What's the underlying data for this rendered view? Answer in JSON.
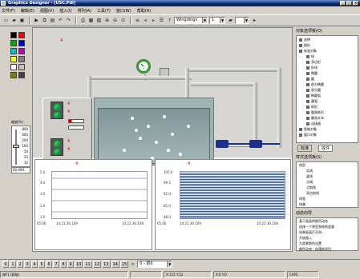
{
  "app": {
    "title": "Graphics Designer - [USC.Pdl]",
    "window_controls": [
      "_",
      "□",
      "×"
    ]
  },
  "menu": [
    "文件(F)",
    "编辑(E)",
    "视图(V)",
    "插入(I)",
    "排列(A)",
    "工具(T)",
    "窗口(W)",
    "帮助(H)"
  ],
  "toolbar": {
    "icons": [
      "new-icon",
      "open-icon",
      "save-icon",
      "run-icon",
      "copy-icon",
      "paste-icon",
      "undo-icon",
      "redo-icon",
      "print-icon",
      "grid-icon",
      "snap-icon",
      "zoom-in-icon",
      "zoom-out-icon",
      "zoom-fit-icon",
      "layer-icon",
      "align-left-icon",
      "align-center-icon",
      "property-icon",
      "help-icon"
    ],
    "font_combo": "Wingdings",
    "size_combo": "1",
    "zoom_combo": ""
  },
  "palette": {
    "colors": [
      "#000000",
      "#ff0000",
      "#00aa00",
      "#0000cc",
      "#00bfbf",
      "#c000c0",
      "#ffff00",
      "#808080",
      "#ffffff",
      "#c0c0c0",
      "#808000",
      "#404040"
    ],
    "zoom_label": "缩放(%)",
    "zoom_ticks": [
      "800",
      "400",
      "200",
      "100",
      "50",
      "25",
      "12"
    ],
    "zoom_value": "100",
    "zoom_field": "60.000"
  },
  "canvas": {
    "marker": "4",
    "panel_marks": [
      "4",
      "4",
      "4",
      "4"
    ],
    "charts": [
      {
        "ylabels": [
          "5.0",
          "4.0",
          "3.0",
          "2.0",
          "1.0"
        ],
        "xlabels": [
          "05.06",
          "14:21:36.109",
          "14:22:36.108"
        ]
      },
      {
        "ylabels": [
          "105.0",
          "99.5",
          "92.0",
          "85.0",
          "88.0"
        ],
        "xlabels": [
          "05.06",
          "14:21:36.109",
          "14:22:36.108"
        ]
      }
    ]
  },
  "objects_pane": {
    "title": "对象选项板(O)",
    "tree": [
      {
        "label": "选择",
        "icon": "cursor-icon"
      },
      {
        "label": "图形",
        "icon": "folder-icon"
      },
      {
        "label": "标准对象",
        "icon": "folder-icon"
      },
      {
        "label": "线",
        "icon": "line-icon"
      },
      {
        "label": "多边形",
        "icon": "polygon-icon"
      },
      {
        "label": "折线",
        "icon": "polyline-icon"
      },
      {
        "label": "椭圆",
        "icon": "ellipse-icon"
      },
      {
        "label": "圆",
        "icon": "circle-icon"
      },
      {
        "label": "部分椭圆",
        "icon": "pie-icon"
      },
      {
        "label": "部分圆",
        "icon": "arc-icon"
      },
      {
        "label": "椭圆弧",
        "icon": "arc-icon"
      },
      {
        "label": "圆弧",
        "icon": "arc-icon"
      },
      {
        "label": "矩形",
        "icon": "rect-icon"
      },
      {
        "label": "圆角矩形",
        "icon": "roundrect-icon"
      },
      {
        "label": "静态文本",
        "icon": "text-icon"
      },
      {
        "label": "连接器",
        "icon": "connector-icon"
      },
      {
        "label": "智能对象",
        "icon": "folder-icon"
      },
      {
        "label": "窗口对象",
        "icon": "folder-icon"
      }
    ],
    "tabs": [
      "标准",
      "控件"
    ]
  },
  "styles_pane": {
    "title": "样式选项板(S)",
    "tree": [
      "线型",
      "实线",
      "虚线",
      "点线",
      "点划线",
      "双点划线",
      "线宽",
      "线端"
    ]
  },
  "dynamic_pane": {
    "title": "动态向导",
    "items": [
      "基于画面的颜色动态",
      "连接一个原型到结构变量",
      "如果画面打开则…",
      "开始画入",
      "为背景颜色设置",
      "颜色动态 - 创建新项目"
    ]
  },
  "pagebar": {
    "tabs": [
      "0",
      "1",
      "2",
      "3",
      "4",
      "5",
      "6",
      "7",
      "8",
      "9",
      "10",
      "11",
      "12",
      "13",
      "14",
      "15"
    ],
    "layer_combo": "0 - 层0"
  },
  "status": [
    "按F1 (获取)",
    "",
    "X:115 Y:12",
    "X:0 Y:0",
    "CAPS"
  ]
}
